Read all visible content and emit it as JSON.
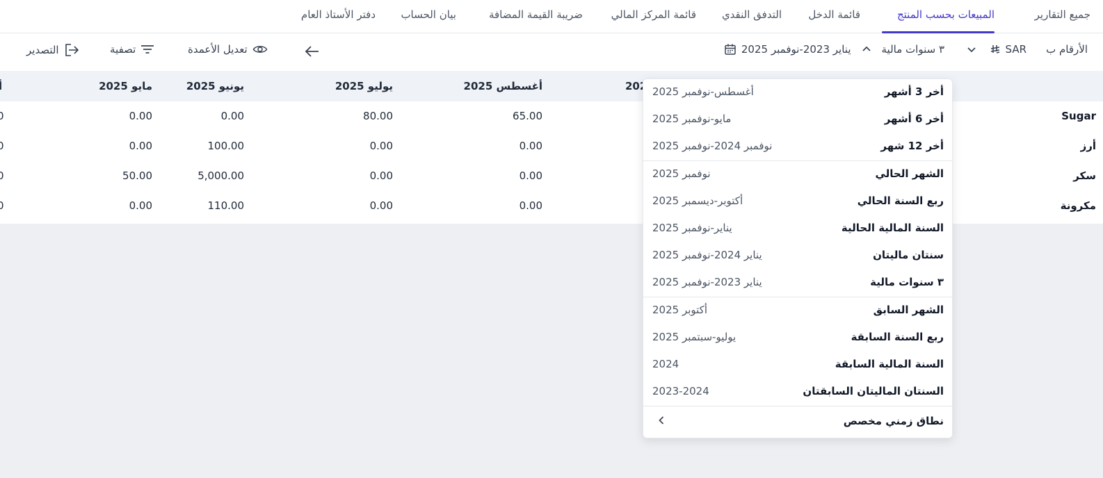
{
  "tabs": [
    {
      "label": "جميع التقارير",
      "active": false
    },
    {
      "label": "المبيعات بحسب المنتج",
      "active": true
    },
    {
      "label": "قائمة الدخل",
      "active": false
    },
    {
      "label": "التدفق النقدي",
      "active": false
    },
    {
      "label": "قائمة المركز المالي",
      "active": false
    },
    {
      "label": "ضريبة القيمة المضافة",
      "active": false
    },
    {
      "label": "بيان الحساب",
      "active": false
    },
    {
      "label": "دفتر الأستاذ العام",
      "active": false
    }
  ],
  "toolbar": {
    "numbers_label": "الأرقام ب",
    "currency": "SAR",
    "period_label": "٣ سنوات مالية",
    "date_range": "يناير 2023-نوفمبر 2025",
    "edit_columns_label": "تعديل الأعمدة",
    "filter_label": "تصفية",
    "export_label": "التصدير"
  },
  "table": {
    "columns": [
      "مايو 2025",
      "يونيو 2025",
      "يوليو 2025",
      "أغسطس 2025",
      "202"
    ],
    "clipped_left_header": "أ",
    "rows": [
      {
        "label": "Sugar",
        "values": [
          "0.00",
          "0.00",
          "80.00",
          "65.00"
        ],
        "clipped": "0"
      },
      {
        "label": "أرز",
        "values": [
          "0.00",
          "100.00",
          "0.00",
          "0.00"
        ],
        "clipped": "0"
      },
      {
        "label": "سكر",
        "values": [
          "50.00",
          "5,000.00",
          "0.00",
          "0.00"
        ],
        "clipped": "0"
      },
      {
        "label": "مكرونة",
        "values": [
          "0.00",
          "110.00",
          "0.00",
          "0.00"
        ],
        "clipped": "0"
      }
    ]
  },
  "date_dropdown": {
    "groups": [
      [
        {
          "label": "أخر 3 أشهر",
          "range": "أغسطس-نوفمبر 2025"
        },
        {
          "label": "أخر 6 أشهر",
          "range": "مايو-نوفمبر 2025"
        },
        {
          "label": "أخر 12 شهر",
          "range": "نوفمبر 2024-نوفمبر 2025"
        }
      ],
      [
        {
          "label": "الشهر الحالي",
          "range": "نوفمبر 2025"
        },
        {
          "label": "ربع السنة الحالي",
          "range": "أكتوبر-ديسمبر 2025"
        },
        {
          "label": "السنة المالية الحالية",
          "range": "يناير-نوفمبر 2025"
        },
        {
          "label": "سنتان ماليتان",
          "range": "يناير 2024-نوفمبر 2025"
        },
        {
          "label": "٣ سنوات مالية",
          "range": "يناير 2023-نوفمبر 2025"
        }
      ],
      [
        {
          "label": "الشهر السابق",
          "range": "أكتوبر 2025"
        },
        {
          "label": "ربع السنة السابقة",
          "range": "يوليو-سبتمبر 2025"
        },
        {
          "label": "السنة المالية السابقة",
          "range": "2024"
        },
        {
          "label": "السنتان الماليتان السابقتان",
          "range": "2023-2024"
        }
      ]
    ],
    "custom_range_label": "نطاق زمني مخصص"
  },
  "colors": {
    "accent": "#4338ca",
    "header_bg": "#eff2f7",
    "page_bg": "#eeeff2"
  },
  "icons": {
    "calendar": "calendar-icon",
    "chevron_up": "chevron-up-icon",
    "chevron_down": "chevron-down-icon",
    "riyal": "riyal-icon",
    "arrow_left": "arrow-left-icon",
    "eye": "eye-icon",
    "filter": "filter-icon",
    "export": "export-icon",
    "chevron_left": "chevron-left-icon"
  }
}
